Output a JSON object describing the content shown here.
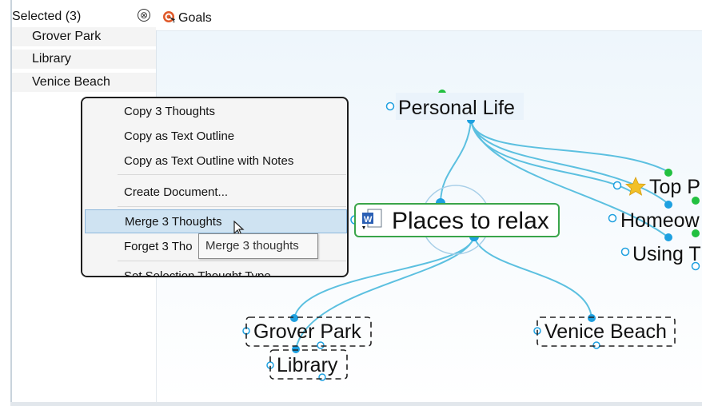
{
  "selection": {
    "header": "Selected (3)",
    "close_glyph": "⊗",
    "items": [
      "Grover Park",
      "Library",
      "Venice Beach"
    ]
  },
  "tab": {
    "label": "Goals",
    "icon": "goals-target-icon"
  },
  "context_menu": {
    "items": [
      {
        "label": "Copy 3 Thoughts"
      },
      {
        "label": "Copy as Text Outline"
      },
      {
        "label": "Copy as Text Outline with Notes"
      },
      {
        "label": "Create Document..."
      },
      {
        "label": "Merge 3 Thoughts",
        "highlighted": true
      },
      {
        "label": "Forget 3 Tho"
      },
      {
        "label": "Set Selection Thought Type"
      }
    ]
  },
  "tooltip": "Merge 3 thoughts",
  "mindmap": {
    "parent": "Personal Life",
    "active": "Places to relax",
    "active_icon": "word-document-icon",
    "siblings": [
      "Top P",
      "Homeow",
      "Using T"
    ],
    "children": [
      "Grover Park",
      "Library",
      "Venice Beach"
    ]
  },
  "colors": {
    "link": "#5cc0e0",
    "node_dot": "#1ea0e0",
    "green_dot": "#22c040",
    "active_border": "#3aa54a",
    "menu_highlight": "#cfe3f2",
    "canvas": "#f4f9fd"
  }
}
